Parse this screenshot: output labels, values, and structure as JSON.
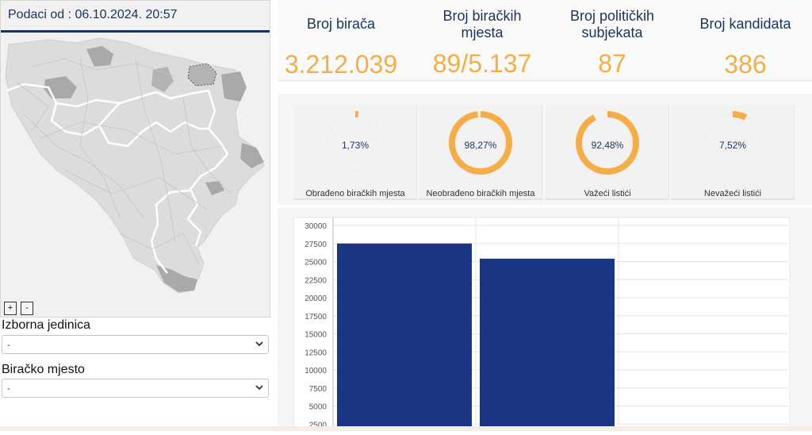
{
  "header": {
    "date_label": "Podaci od : 06.10.2024. 20:57"
  },
  "map": {
    "zoom_in": "+",
    "zoom_out": "-"
  },
  "filters": {
    "izborna_label": "Izborna jedinica",
    "izborna_value": "-",
    "mjesto_label": "Biračko mjesto",
    "mjesto_value": "-"
  },
  "stats": [
    {
      "title": "Broj birača",
      "value": "3.212.039"
    },
    {
      "title": "Broj biračkih mjesta",
      "value": "89/5.137"
    },
    {
      "title": "Broj političkih subjekata",
      "value": "87"
    },
    {
      "title": "Broj kandidata",
      "value": "386"
    }
  ],
  "gauges": [
    {
      "percent_text": "1,73%",
      "fraction": 0.0173,
      "label": "Obrađeno biračkih mjesta"
    },
    {
      "percent_text": "98,27%",
      "fraction": 0.9827,
      "label": "Neobrađeno biračkih mjesta"
    },
    {
      "percent_text": "92,48%",
      "fraction": 0.9248,
      "label": "Važeći listići"
    },
    {
      "percent_text": "7,52%",
      "fraction": 0.0752,
      "label": "Nevažeći listići"
    }
  ],
  "colors": {
    "accent": "#f5ad4a",
    "navy": "#1b3358",
    "bar": "#1a3582"
  },
  "chart_data": {
    "type": "bar",
    "categories": [
      "",
      ""
    ],
    "values": [
      27500,
      25400
    ],
    "ylim": [
      0,
      30000
    ],
    "yticks": [
      "30000",
      "27500",
      "25000",
      "22500",
      "20000",
      "17500",
      "15000",
      "12500",
      "10000",
      "7500",
      "5000",
      "2500"
    ],
    "grid": true
  }
}
